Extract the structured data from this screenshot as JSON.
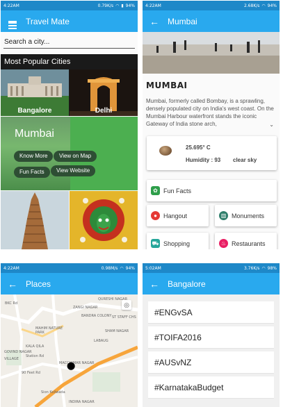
{
  "panel1": {
    "status": {
      "time": "4:22AM",
      "speed": "0.79K/s",
      "battery": "94%"
    },
    "app_title": "Travel Mate",
    "search_placeholder": "Search a city...",
    "popular_title": "Most Popular Cities",
    "cities": [
      "Bangalore",
      "Delhi"
    ],
    "card": {
      "title": "Mumbai",
      "chips": [
        "Know More",
        "View on Map",
        "Fun Facts",
        "View Website"
      ]
    }
  },
  "panel2": {
    "status": {
      "time": "4:22AM",
      "speed": "2.68K/s",
      "battery": "94%"
    },
    "title": "Mumbai",
    "heading": "MUMBAI",
    "description": "Mumbai, formerly called Bombay, is a sprawling, densely populated city on India's west coast. On the Mumbai Harbour waterfront stands the iconic Gateway of India stone arch,",
    "weather": {
      "temp": "25.695° C",
      "humidity": "Humidity : 93",
      "sky": "clear sky"
    },
    "fun_facts": "Fun Facts",
    "buttons": [
      "Hangout",
      "Monuments",
      "Shopping",
      "Restaurants"
    ]
  },
  "panel3": {
    "status": {
      "time": "4:22AM",
      "speed": "0.98M/s",
      "battery": "94%"
    },
    "title": "Places",
    "map_labels": [
      "QURESHI NAGAR",
      "MAHIM NATURE PARK",
      "KALA QILA",
      "GOVIND NAGAR",
      "BANDRA COLONY",
      "ST STAFF CHS",
      "SHAM NAGAR",
      "LABAUG",
      "Station Rd",
      "MACCHIMAR NAGAR",
      "90 Feet Rd",
      "Sion Koliwada",
      "INDIRA NAGAR",
      "BKC Rd",
      "ZANGI NAGAR",
      "VILLAGE"
    ]
  },
  "panel4": {
    "status": {
      "time": "5:02AM",
      "speed": "3.76K/s",
      "battery": "98%"
    },
    "title": "Bangalore",
    "tags": [
      "#ENGvSA",
      "#TOIFA2016",
      "#AUSvNZ",
      "#KarnatakaBudget"
    ]
  },
  "colors": {
    "appbar": "#29a9ee",
    "statusbar": "#1e88c8",
    "card_green": "#4caf50"
  }
}
